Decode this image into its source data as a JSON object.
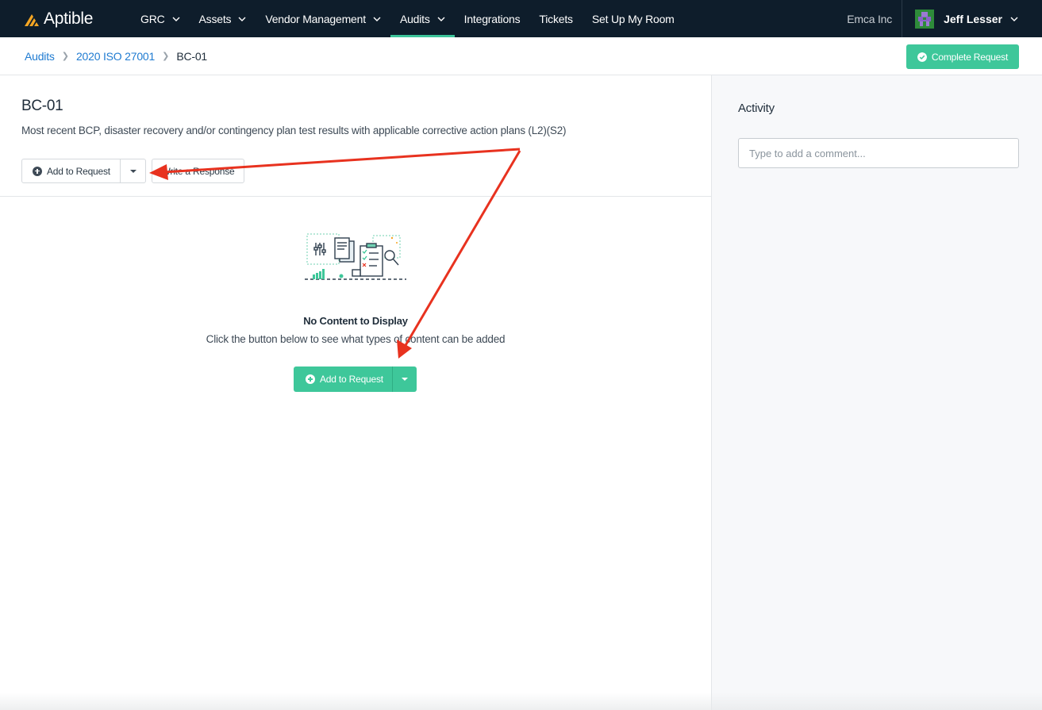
{
  "brand": {
    "name": "Aptible",
    "accent": "#3ec79a",
    "logo_color": "#f5a623",
    "nav_bg": "#0e1d2b"
  },
  "nav": {
    "items": [
      {
        "label": "GRC",
        "has_menu": true
      },
      {
        "label": "Assets",
        "has_menu": true
      },
      {
        "label": "Vendor Management",
        "has_menu": true
      },
      {
        "label": "Audits",
        "has_menu": true,
        "active": true
      },
      {
        "label": "Integrations",
        "has_menu": false
      },
      {
        "label": "Tickets",
        "has_menu": false
      },
      {
        "label": "Set Up My Room",
        "has_menu": false
      }
    ],
    "org": "Emca Inc",
    "user": "Jeff Lesser"
  },
  "breadcrumb": {
    "items": [
      "Audits",
      "2020 ISO 27001"
    ],
    "current": "BC-01"
  },
  "actions": {
    "complete_label": "Complete Request"
  },
  "request": {
    "title": "BC-01",
    "description": "Most recent BCP, disaster recovery and/or contingency plan test results with applicable corrective action plans (L2)(S2)",
    "add_label": "Add to Request",
    "write_label": "Write a Response"
  },
  "empty": {
    "title": "No Content to Display",
    "subtitle": "Click the button below to see what types of content can be added",
    "add_label": "Add to Request"
  },
  "activity": {
    "title": "Activity",
    "comment_placeholder": "Type to add a comment..."
  },
  "annotation": {
    "arrow_color": "#e8321f"
  }
}
